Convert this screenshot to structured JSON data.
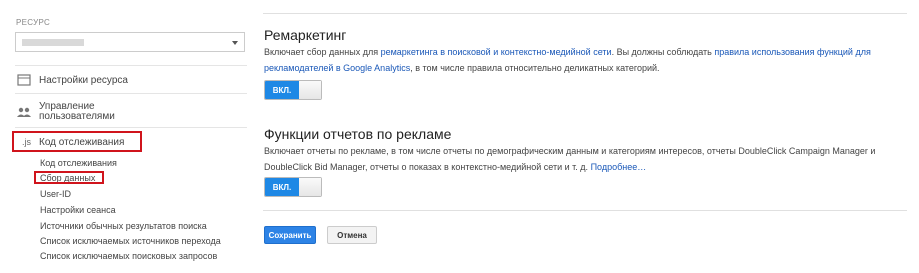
{
  "sidebar": {
    "resource_label": "РЕСУРС",
    "nav": {
      "settings": "Настройки ресурса",
      "users_line1": "Управление",
      "users_line2": "пользователями",
      "tracking_icon": ".js",
      "tracking": "Код отслеживания"
    },
    "sub_items": [
      "Код отслеживания",
      "Сбор данных",
      "User-ID",
      "Настройки сеанса",
      "Источники обычных результатов поиска",
      "Список исключаемых источников перехода",
      "Список исключаемых поисковых запросов"
    ]
  },
  "remarketing": {
    "title": "Ремаркетинг",
    "desc_1": "Включает сбор данных для ",
    "link_1": "ремаркетинга в поисковой и контекстно-медийной сети",
    "desc_2": ". Вы должны соблюдать ",
    "link_2": "правила использования функций для рекламодателей в Google Analytics",
    "desc_3": ", в том числе правила относительно деликатных категорий.",
    "toggle_label": "ВКЛ."
  },
  "ad_reports": {
    "title": "Функции отчетов по рекламе",
    "desc": "Включает отчеты по рекламе, в том числе отчеты по демографическим данным и категориям интересов, отчеты DoubleClick Campaign Manager и DoubleClick Bid Manager, отчеты о показах в контекстно-медийной сети и т. д. ",
    "more_link": "Подробнее…",
    "toggle_label": "ВКЛ."
  },
  "actions": {
    "save": "Сохранить",
    "cancel": "Отмена"
  },
  "colors": {
    "accent": "#1e88e5",
    "highlight_box": "#d0141c",
    "link": "#1a58b8"
  }
}
